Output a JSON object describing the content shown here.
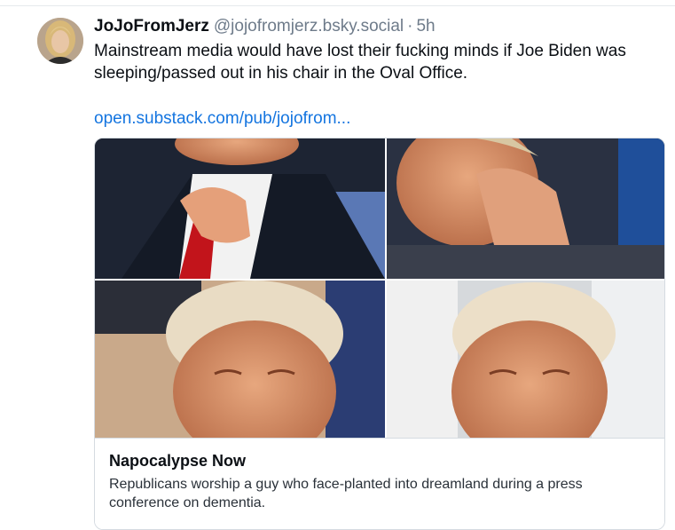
{
  "post": {
    "display_name": "JoJoFromJerz",
    "handle": "@jojofromjerz.bsky.social",
    "separator": "·",
    "timestamp": "5h",
    "text": "Mainstream media would have lost their fucking minds if Joe Biden was sleeping/passed out in his chair in the Oval Office.",
    "link_text": "open.substack.com/pub/jojofrom...",
    "avatar_icon": "user-avatar-photo"
  },
  "card": {
    "title": "Napocalypse Now",
    "description": "Republicans worship a guy who face-planted into dreamland during a press conference on dementia.",
    "image_icon": "photo-collage-image"
  },
  "colors": {
    "link": "#1475e0",
    "muted_text": "#6e7b8a",
    "border": "#d5dbe1"
  }
}
